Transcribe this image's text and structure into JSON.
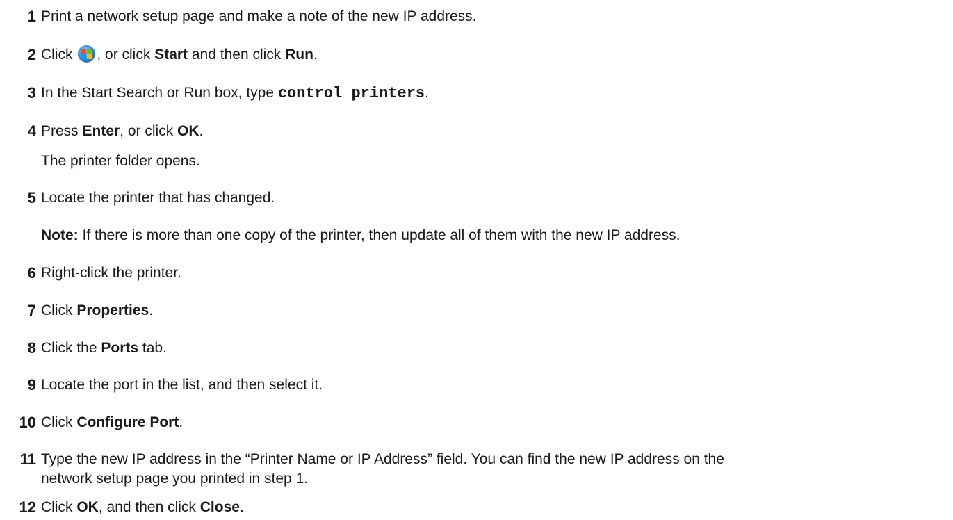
{
  "steps": [
    {
      "num": "1",
      "parts": [
        "Print a network setup page and make a note of the new IP address."
      ]
    },
    {
      "num": "2",
      "parts": [
        "Click ",
        ", or click ",
        "Start",
        " and then click ",
        "Run",
        "."
      ]
    },
    {
      "num": "3",
      "parts": [
        "In the Start Search or Run box, type ",
        "control printers",
        "."
      ]
    },
    {
      "num": "4",
      "parts": [
        "Press ",
        "Enter",
        ", or click ",
        "OK",
        "."
      ],
      "continuation": "The printer folder opens."
    },
    {
      "num": "5",
      "parts": [
        "Locate the printer that has changed."
      ],
      "note_label": "Note:",
      "note_text": " If there is more than one copy of the printer, then update all of them with the new IP address."
    },
    {
      "num": "6",
      "parts": [
        "Right-click the printer."
      ]
    },
    {
      "num": "7",
      "parts": [
        "Click ",
        "Properties",
        "."
      ]
    },
    {
      "num": "8",
      "parts": [
        "Click the ",
        "Ports",
        " tab."
      ]
    },
    {
      "num": "9",
      "parts": [
        "Locate the port in the list, and then select it."
      ]
    },
    {
      "num": "10",
      "parts": [
        "Click ",
        "Configure Port",
        "."
      ]
    },
    {
      "num": "11",
      "parts": [
        "Type the new IP address in the “Printer Name or IP Address” field. You can find the new IP address on the"
      ],
      "continuation": "network setup page you printed in step 1."
    },
    {
      "num": "12",
      "parts": [
        "Click ",
        "OK",
        ", and then click ",
        "Close",
        "."
      ]
    }
  ],
  "icons": {
    "start_orb": "windows-start-orb-icon"
  }
}
